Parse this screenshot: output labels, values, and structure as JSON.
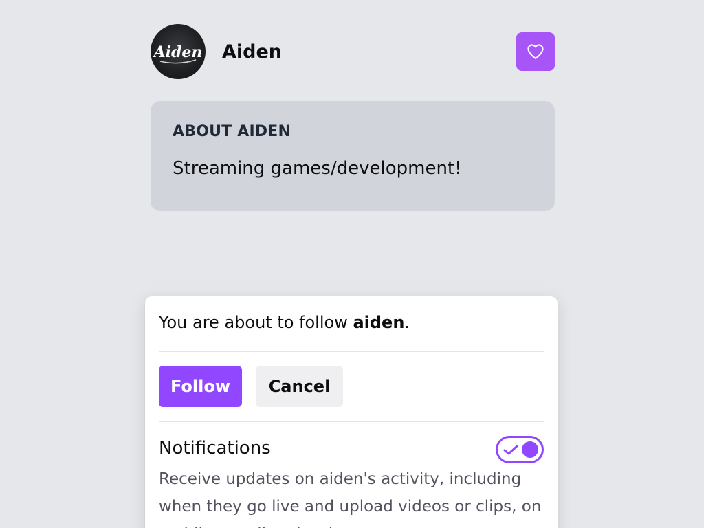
{
  "channel": {
    "name": "Aiden",
    "avatar_text": "Aiden",
    "favorite_icon": "heart-icon"
  },
  "about": {
    "heading": "ABOUT AIDEN",
    "text": "Streaming games/development!"
  },
  "dialog": {
    "message_prefix": "You are about to follow ",
    "message_user": "aiden",
    "message_suffix": ".",
    "follow_label": "Follow",
    "cancel_label": "Cancel",
    "notifications_title": "Notifications",
    "notifications_enabled": true,
    "notifications_description": "Receive updates on aiden's activity, including when they go live and upload videos or clips, on mobile, email and web."
  },
  "colors": {
    "page_bg": "#e5e7eb",
    "accent": "#9146ff",
    "favorite_bg": "#a855f7",
    "card_bg": "#d1d5db"
  }
}
